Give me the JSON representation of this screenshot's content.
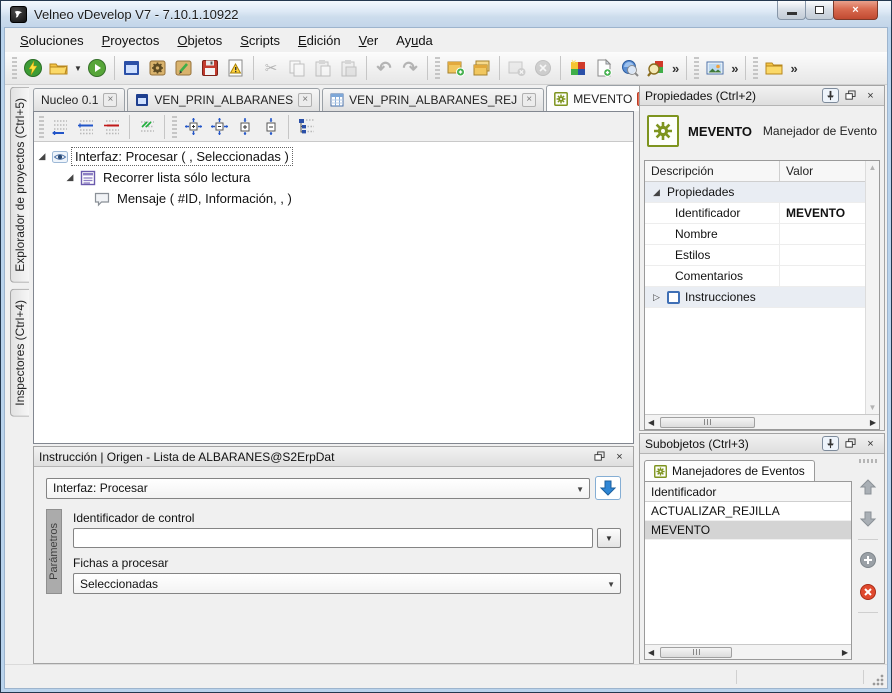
{
  "window": {
    "title": "Velneo vDevelop V7 - 7.10.1.10922"
  },
  "menu": {
    "items": [
      {
        "pre": "",
        "u": "S",
        "post": "oluciones"
      },
      {
        "pre": "",
        "u": "P",
        "post": "royectos"
      },
      {
        "pre": "",
        "u": "O",
        "post": "bjetos"
      },
      {
        "pre": "",
        "u": "S",
        "post": "cripts"
      },
      {
        "pre": "",
        "u": "E",
        "post": "dición"
      },
      {
        "pre": "",
        "u": "V",
        "post": "er"
      },
      {
        "pre": "Ay",
        "u": "u",
        "post": "da"
      }
    ]
  },
  "main_toolbar": {
    "icons": [
      "connect",
      "open-solution",
      "run",
      "new-form",
      "object-properties",
      "object-edit",
      "save",
      "error-list",
      "cut",
      "copy",
      "paste",
      "paste-special",
      "undo",
      "redo",
      "new-window",
      "windows",
      "close-window",
      "close-all",
      "color-scheme",
      "new-document",
      "search-objects",
      "search-in-colors",
      "images",
      "folders"
    ]
  },
  "tabs": {
    "items": [
      {
        "label": "Nucleo 0.1",
        "icon": "none"
      },
      {
        "label": "VEN_PRIN_ALBARANES",
        "icon": "form-icon"
      },
      {
        "label": "VEN_PRIN_ALBARANES_REJ",
        "icon": "grid-icon"
      },
      {
        "label": "MEVENTO",
        "icon": "event-handler-icon",
        "active": true
      }
    ]
  },
  "side_tabs": {
    "explorer": "Explorador de proyectos (Ctrl+5)",
    "inspectors": "Inspectores (Ctrl+4)"
  },
  "editor": {
    "toolbar_icons": [
      "add-line",
      "insert-line",
      "delete-line",
      "comment-line",
      "expand-all",
      "collapse-all",
      "expand-node",
      "collapse-node",
      "tree-view"
    ],
    "tree": [
      {
        "label": "Interfaz: Procesar ( , Seleccionadas )",
        "icon": "interface-eye-icon",
        "selected": true
      },
      {
        "label": "Recorrer lista sólo lectura",
        "icon": "loop-list-icon"
      },
      {
        "label": "Mensaje ( #ID, Información, ,  )",
        "icon": "message-icon"
      }
    ]
  },
  "instruction_panel": {
    "title": "Instrucción | Origen - Lista de ALBARANES@S2ErpDat",
    "instruction_value": "Interfaz: Procesar",
    "params_label": "Parámetros",
    "field1_label": "Identificador de control",
    "field1_value": "",
    "field2_label": "Fichas a procesar",
    "field2_value": "Seleccionadas"
  },
  "properties_panel": {
    "title": "Propiedades (Ctrl+2)",
    "object_id": "MEVENTO",
    "object_type": "Manejador de Evento",
    "col1": "Descripción",
    "col2": "Valor",
    "group1": "Propiedades",
    "rows": [
      {
        "name": "Identificador",
        "value": "MEVENTO"
      },
      {
        "name": "Nombre",
        "value": ""
      },
      {
        "name": "Estilos",
        "value": ""
      },
      {
        "name": "Comentarios",
        "value": ""
      }
    ],
    "group2": "Instrucciones"
  },
  "subobjects_panel": {
    "title": "Subobjetos (Ctrl+3)",
    "tab": "Manejadores de Eventos",
    "column": "Identificador",
    "rows": [
      "ACTUALIZAR_REJILLA",
      "MEVENTO"
    ],
    "selected_row": "MEVENTO"
  },
  "icons": {
    "close": "×",
    "minimize": "",
    "restore": "",
    "chev_left": "◀",
    "chev_right": "▶",
    "up_small": "▲",
    "down_small": "▼",
    "combo_arrow": "▼",
    "overflow": "»",
    "cut": "✂",
    "undo": "↶",
    "redo": "↷",
    "exp_open": "◢",
    "exp_closed": "▷",
    "caret_down": "▼"
  },
  "colors": {
    "accent_blue": "#2e86d5",
    "olive_green": "#7e941f",
    "close_red": "#c14a31",
    "selection_gray": "#d4d4d4",
    "frame_blue": "#b9d3ec"
  }
}
